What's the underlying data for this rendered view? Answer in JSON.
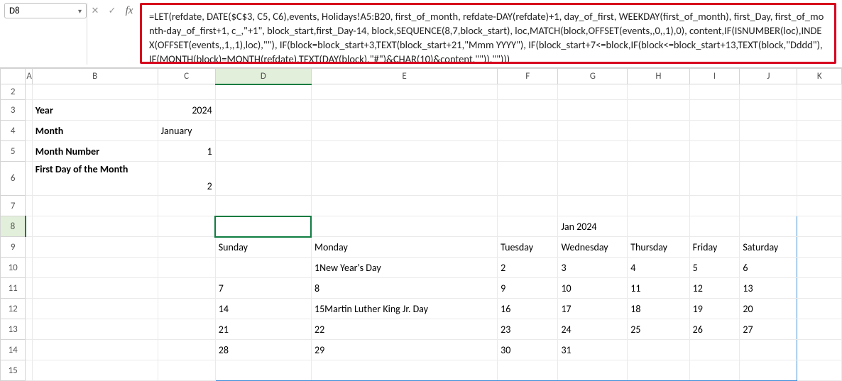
{
  "header": {
    "namebox": "D8",
    "formula": "=LET(refdate, DATE($C$3, C5, C6),events, Holidays!A5:B20, first_of_month, refdate-DAY(refdate)+1, day_of_first, WEEKDAY(first_of_month), first_Day, first_of_month-day_of_first+1, c_,\"+1\", block_start,first_Day-14, block,SEQUENCE(8,7,block_start), loc,MATCH(block,OFFSET(events,,0,,1),0), content,IF(ISNUMBER(loc),INDEX(OFFSET(events,,1,,1),loc),\"\"), IF(block=block_start+3,TEXT(block_start+21,\"Mmm YYYY\"), IF(block_start+7<=block,IF(block<=block_start+13,TEXT(block,\"Dddd\"), IF(MONTH(block)=MONTH(refdate),TEXT(DAY(block),\"#\")&CHAR(10)&content,\"\")),\"\")))"
  },
  "columns": [
    "A",
    "B",
    "C",
    "D",
    "E",
    "F",
    "G",
    "H",
    "I",
    "J",
    "K"
  ],
  "rows": [
    "2",
    "3",
    "4",
    "5",
    "6",
    "7",
    "8",
    "9",
    "10",
    "11",
    "12",
    "13",
    "14",
    "15"
  ],
  "labels": {
    "year": "Year",
    "month": "Month",
    "monthnum": "Month Number",
    "firstday": "First Day of the Month"
  },
  "inputs": {
    "year": "2024",
    "month": "January",
    "monthnum": "1",
    "firstday": "2"
  },
  "calendar": {
    "title": "Jan 2024",
    "days": [
      "Sunday",
      "Monday",
      "Tuesday",
      "Wednesday",
      "Thursday",
      "Friday",
      "Saturday"
    ],
    "grid": [
      [
        "",
        "1New Year's Day",
        "2",
        "3",
        "4",
        "5",
        "6"
      ],
      [
        "7",
        "8",
        "9",
        "10",
        "11",
        "12",
        "13"
      ],
      [
        "14",
        "15Martin Luther King Jr. Day",
        "16",
        "17",
        "18",
        "19",
        "20"
      ],
      [
        "21",
        "22",
        "23",
        "24",
        "25",
        "26",
        "27"
      ],
      [
        "28",
        "29",
        "30",
        "31",
        "",
        "",
        ""
      ]
    ]
  },
  "chart_data": {
    "type": "table",
    "title": "Jan 2024",
    "columns": [
      "Sunday",
      "Monday",
      "Tuesday",
      "Wednesday",
      "Thursday",
      "Friday",
      "Saturday"
    ],
    "rows": [
      [
        "",
        "1 New Year's Day",
        "2",
        "3",
        "4",
        "5",
        "6"
      ],
      [
        "7",
        "8",
        "9",
        "10",
        "11",
        "12",
        "13"
      ],
      [
        "14",
        "15 Martin Luther King Jr. Day",
        "16",
        "17",
        "18",
        "19",
        "20"
      ],
      [
        "21",
        "22",
        "23",
        "24",
        "25",
        "26",
        "27"
      ],
      [
        "28",
        "29",
        "30",
        "31",
        "",
        "",
        ""
      ]
    ]
  }
}
